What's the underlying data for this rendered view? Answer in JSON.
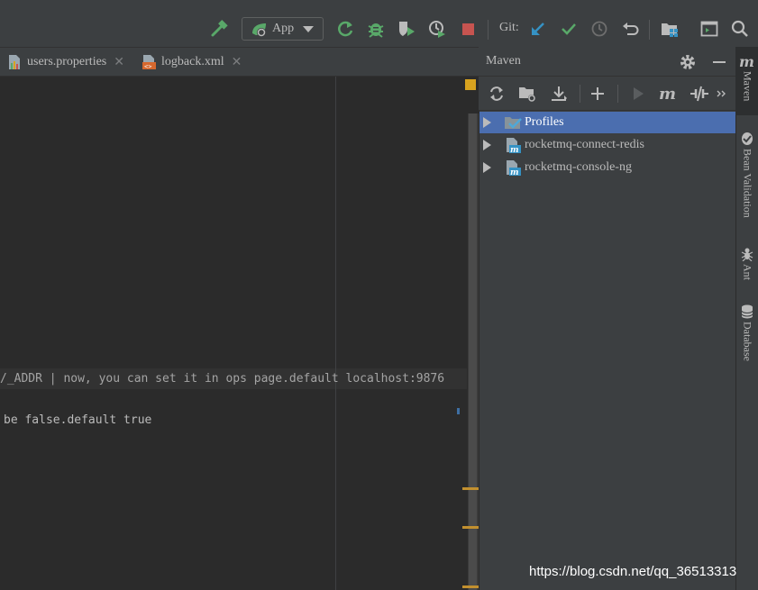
{
  "toolbar": {
    "run_config_label": "App",
    "git_label": "Git:"
  },
  "tabs": [
    {
      "label": "users.properties"
    },
    {
      "label": "logback.xml"
    }
  ],
  "editor": {
    "line1": "/_ADDR | now, you can set it in ops page.default localhost:9876",
    "line2": "be false.default true"
  },
  "maven": {
    "title": "Maven",
    "tree": [
      {
        "label": "Profiles",
        "selected": true
      },
      {
        "label": "rocketmq-connect-redis"
      },
      {
        "label": "rocketmq-console-ng"
      }
    ]
  },
  "side_tabs": [
    {
      "label": "Maven",
      "icon": "maven-icon"
    },
    {
      "label": "Bean Validation",
      "icon": "bean-validation-icon"
    },
    {
      "label": "Ant",
      "icon": "ant-icon"
    },
    {
      "label": "Database",
      "icon": "database-icon"
    }
  ],
  "watermark": "https://blog.csdn.net/qq_36513313",
  "colors": {
    "accent_selection": "#4b6eaf",
    "run_green": "#59a869",
    "stop_red": "#c75450",
    "vcs_blue": "#3592c4",
    "warning_yellow": "#d8a31f"
  }
}
